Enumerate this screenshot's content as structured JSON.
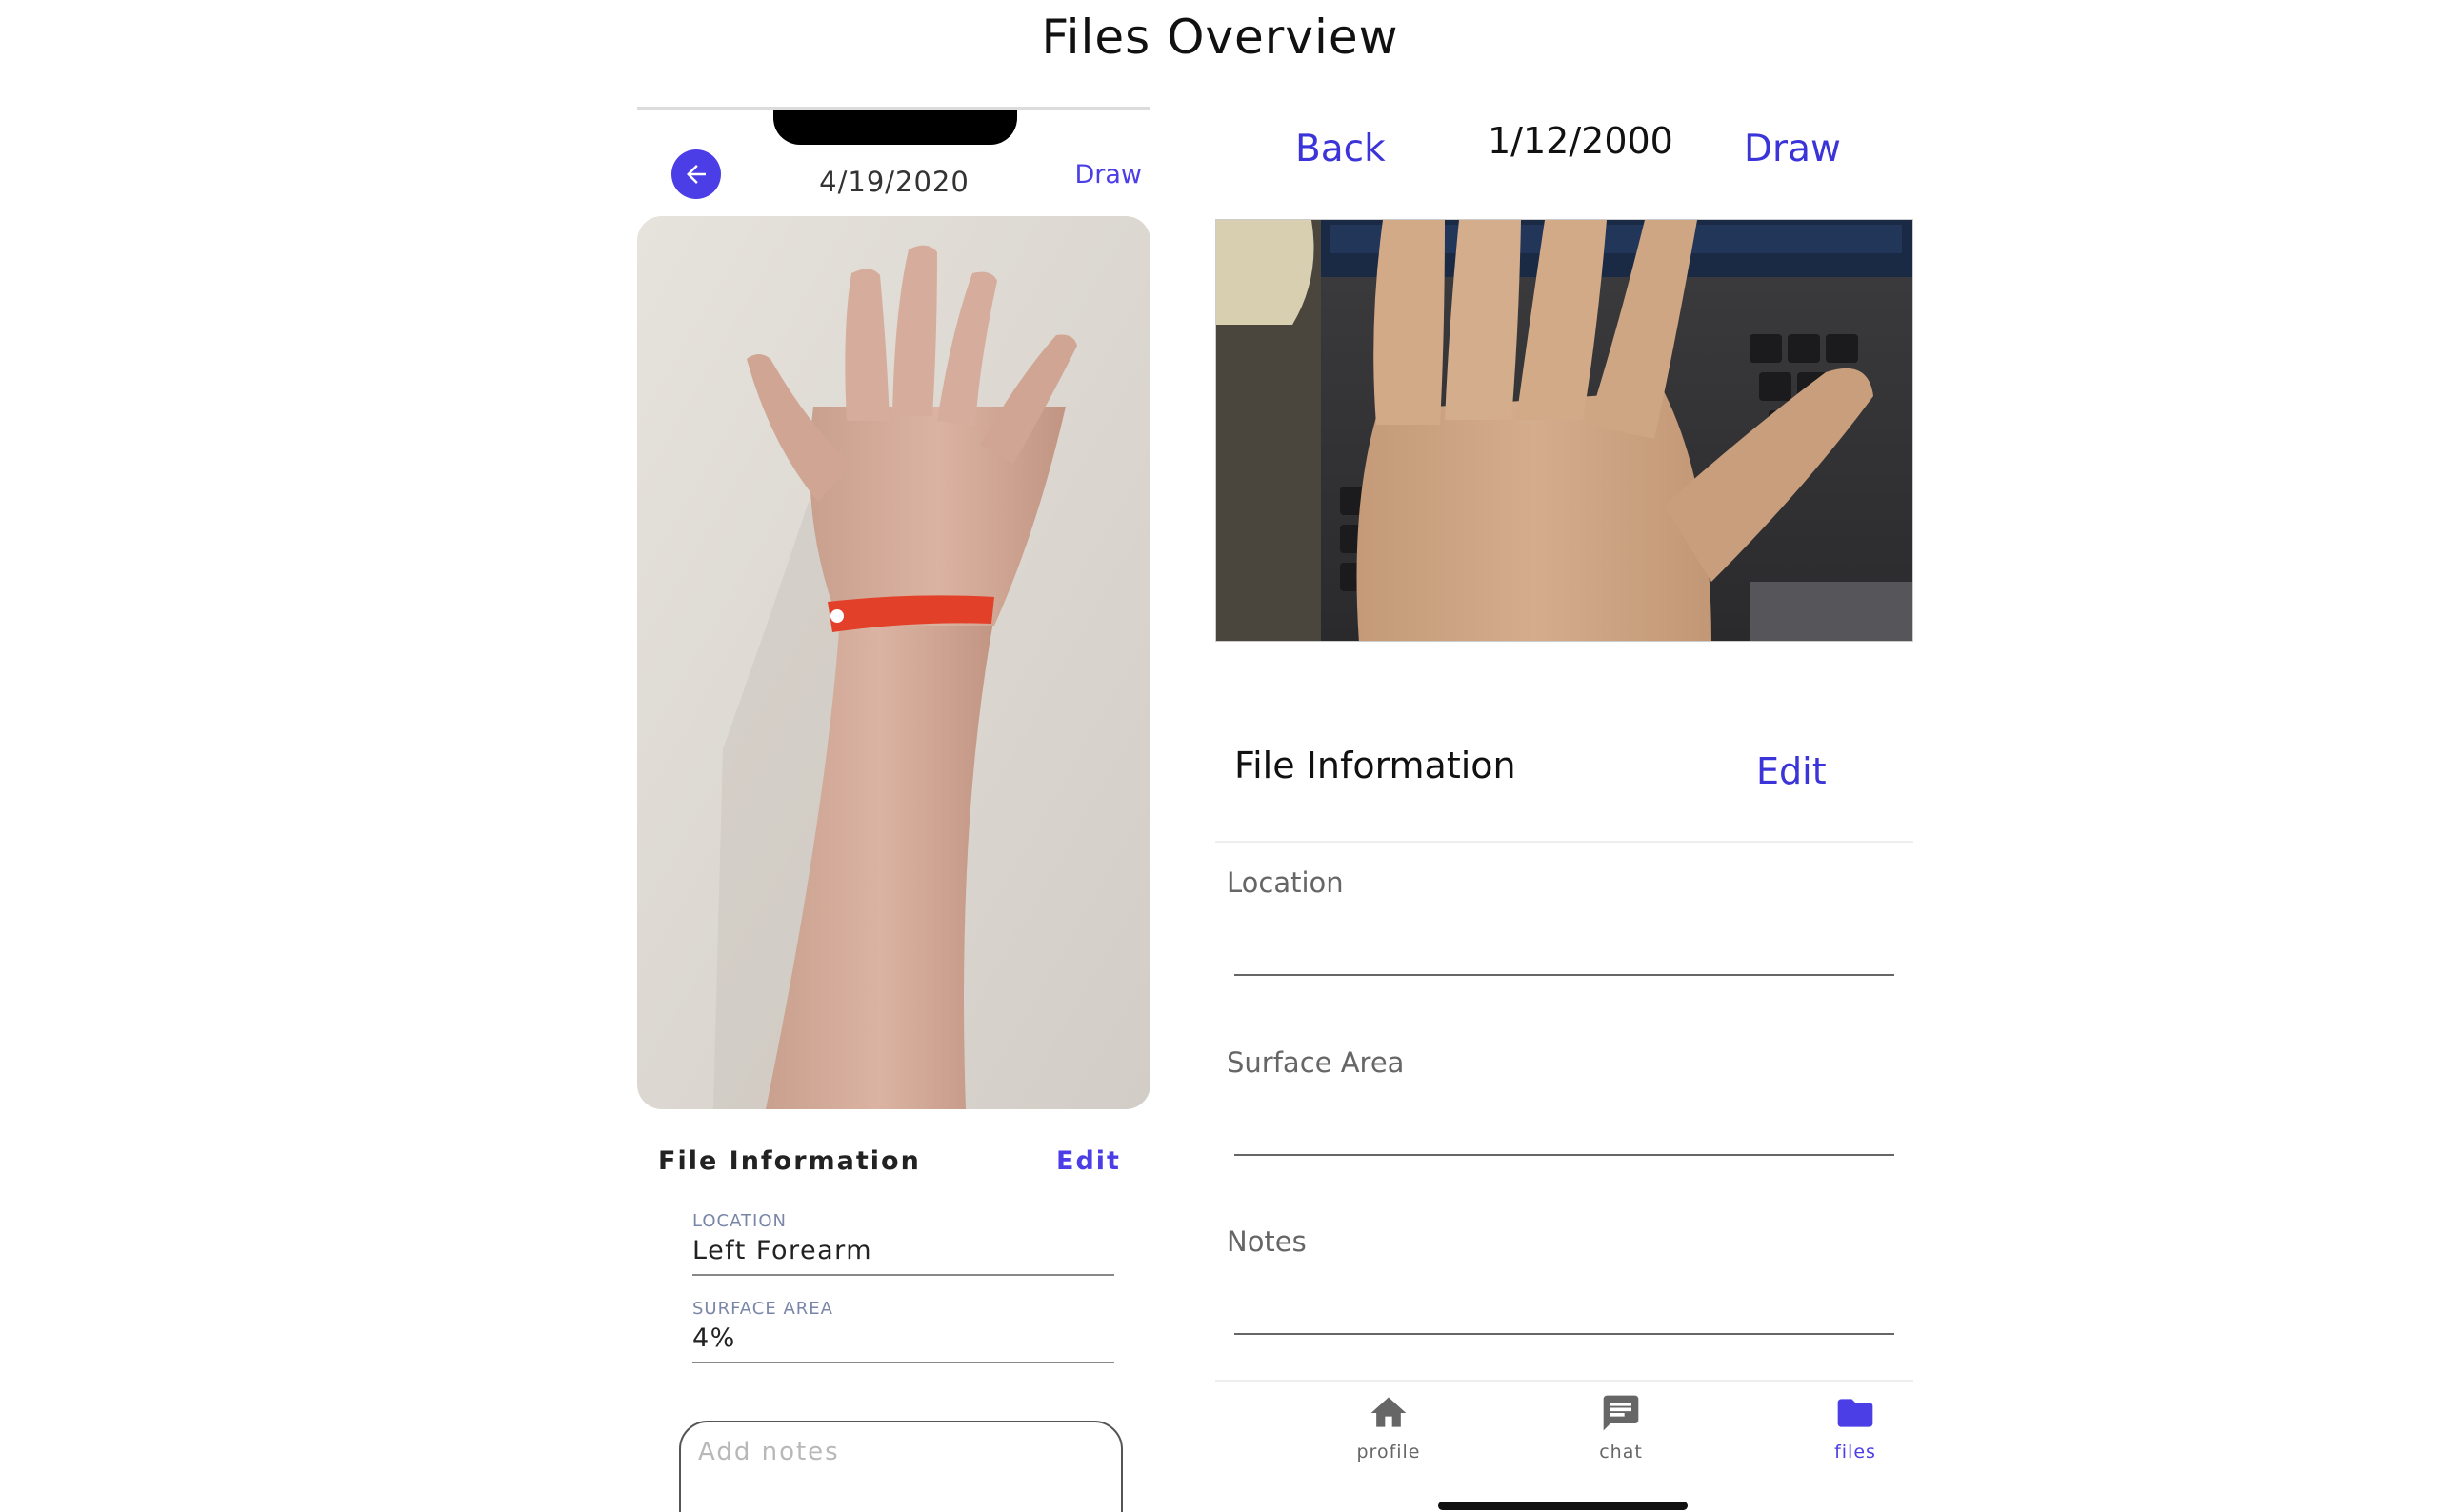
{
  "page": {
    "title": "Files Overview"
  },
  "left_phone": {
    "date": "4/19/2020",
    "draw_label": "Draw",
    "file_info": {
      "title": "File Information",
      "edit_label": "Edit",
      "location_label": "LOCATION",
      "location_value": "Left Forearm",
      "surface_area_label": "SURFACE AREA",
      "surface_area_value": "4%",
      "notes_placeholder": "Add notes"
    }
  },
  "right_phone": {
    "back_label": "Back",
    "date": "1/12/2000",
    "draw_label": "Draw",
    "file_info": {
      "title": "File Information",
      "edit_label": "Edit",
      "location_label": "Location",
      "surface_area_label": "Surface Area",
      "notes_label": "Notes"
    },
    "tabs": [
      {
        "label": "profile",
        "icon": "home-icon",
        "active": false
      },
      {
        "label": "chat",
        "icon": "chat-icon",
        "active": false
      },
      {
        "label": "files",
        "icon": "folder-icon",
        "active": true
      }
    ]
  },
  "colors": {
    "accent": "#4b3ee6",
    "link": "#3b34d8",
    "inactive_tab": "#666666"
  }
}
